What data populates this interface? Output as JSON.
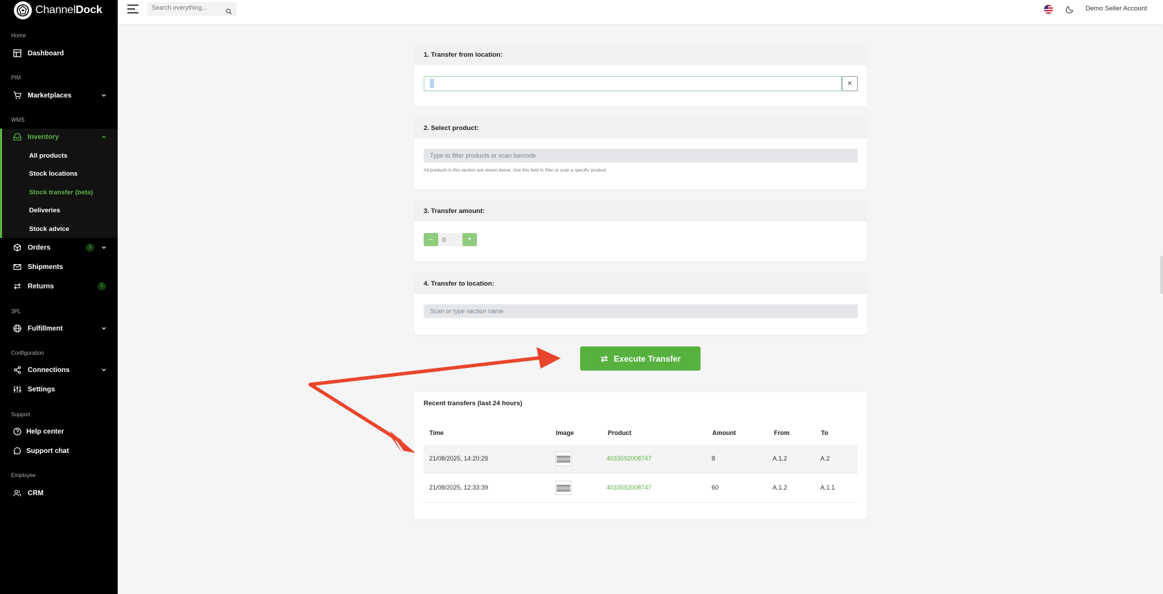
{
  "brand": {
    "name_light": "Channel",
    "name_bold": "Dock"
  },
  "sidebar": {
    "sections": {
      "home": "Home",
      "pim": "PIM",
      "wms": "WMS",
      "tpl": "3PL",
      "configuration": "Configuration",
      "support": "Support",
      "employee": "Employee"
    },
    "items": {
      "dashboard": "Dashboard",
      "marketplaces": "Marketplaces",
      "inventory": "Inventory",
      "orders": "Orders",
      "orders_badge": "1",
      "shipments": "Shipments",
      "returns": "Returns",
      "returns_badge": "1",
      "fulfillment": "Fulfillment",
      "connections": "Connections",
      "settings": "Settings",
      "help_center": "Help center",
      "support_chat": "Support chat",
      "crm": "CRM"
    },
    "inventory_sub": {
      "all_products": "All products",
      "stock_locations": "Stock locations",
      "stock_transfer": "Stock transfer (beta)",
      "deliveries": "Deliveries",
      "stock_advice": "Stock advice"
    },
    "accent_color": "#5cb346"
  },
  "topbar": {
    "search_placeholder": "Search everything...",
    "account": "Demo Seller Account"
  },
  "transfer": {
    "step1": {
      "title": "1. Transfer from location:",
      "value": "a",
      "clear": "×"
    },
    "step2": {
      "title": "2. Select product:",
      "placeholder": "Type to filter products or scan barcode",
      "help": "All products in this section are shown below. Use this field to filter or scan a specific product."
    },
    "step3": {
      "title": "3. Transfer amount:",
      "minus": "–",
      "plus": "+",
      "value": "0"
    },
    "step4": {
      "title": "4. Transfer to location:",
      "placeholder": "Scan or type section name"
    },
    "execute_label": "Execute Transfer"
  },
  "recent": {
    "title": "Recent transfers (last 24 hours)",
    "columns": {
      "time": "Time",
      "image": "Image",
      "product": "Product",
      "amount": "Amount",
      "from": "From",
      "to": "To"
    },
    "rows": [
      {
        "time": "21/08/2025, 14:20:29",
        "product": "4033592008747",
        "amount": "8",
        "from": "A.1.2",
        "to": "A.2"
      },
      {
        "time": "21/08/2025, 12:33:39",
        "product": "4033592008747",
        "amount": "60",
        "from": "A.1.2",
        "to": "A.1.1"
      }
    ]
  },
  "annotation_color": "#e8452c"
}
